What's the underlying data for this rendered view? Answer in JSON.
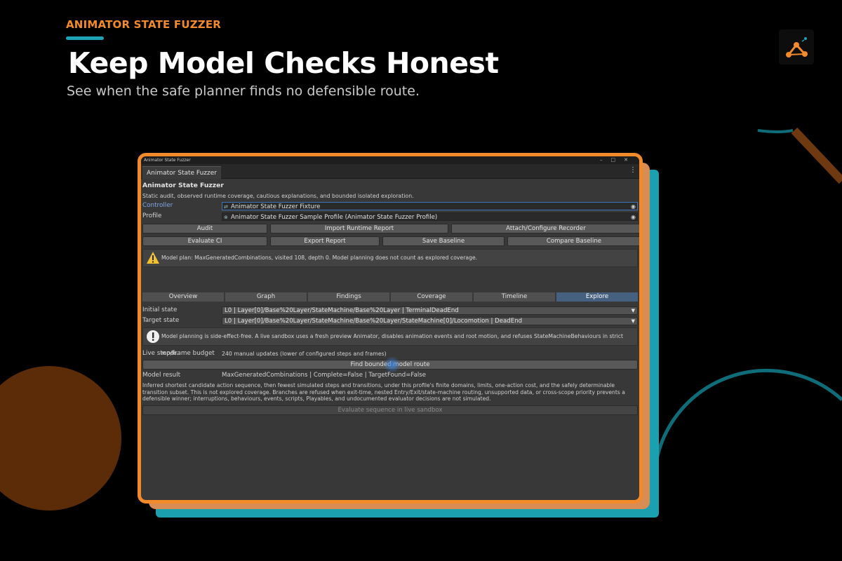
{
  "banner": {
    "kicker": "ANIMATOR STATE FUZZER",
    "headline": "Keep Model Checks Honest",
    "subline": "See when the safe planner finds no defensible route.",
    "accent_orange": "#f28a2a",
    "accent_teal": "#1ea5b5"
  },
  "window": {
    "title": "Animator State Fuzzer",
    "tab_label": "Animator State Fuzzer",
    "heading": "Animator State Fuzzer",
    "description": "Static audit, observed runtime coverage, cautious explanations, and bounded isolated exploration.",
    "controller": {
      "label": "Controller",
      "value": "Animator State Fuzzer Fixture"
    },
    "profile": {
      "label": "Profile",
      "value": "Animator State Fuzzer Sample Profile (Animator State Fuzzer Profile)"
    },
    "buttons_row1": [
      "Audit",
      "Import Runtime Report",
      "Attach/Configure Recorder"
    ],
    "buttons_row2": [
      "Evaluate CI",
      "Export Report",
      "Save Baseline",
      "Compare Baseline"
    ],
    "warning": "Model plan: MaxGeneratedCombinations, visited 108, depth 0. Model planning does not count as explored coverage.",
    "tabs": [
      {
        "label": "Overview",
        "selected": false
      },
      {
        "label": "Graph",
        "selected": false
      },
      {
        "label": "Findings",
        "selected": false
      },
      {
        "label": "Coverage",
        "selected": false
      },
      {
        "label": "Timeline",
        "selected": false
      },
      {
        "label": "Explore",
        "selected": true
      }
    ],
    "initial_state": {
      "label": "Initial state",
      "value": "L0 | Layer[0]/Base%20Layer/StateMachine/Base%20Layer | TerminalDeadEnd"
    },
    "target_state": {
      "label": "Target state",
      "value": "L0 | Layer[0]/Base%20Layer/StateMachine/Base%20Layer/StateMachine[0]/Locomotion | DeadEnd"
    },
    "info": "Model planning is side-effect-free. A live sandbox uses a fresh preview Animator, disables animation events and root motion, and refuses StateMachineBehaviours in strict mode.",
    "budget": {
      "label": "Live step/frame budget",
      "value": "240 manual updates (lower of configured steps and frames)"
    },
    "find_button": "Find bounded model route",
    "model_result": {
      "label": "Model result",
      "value": "MaxGeneratedCombinations | Complete=False | TargetFound=False"
    },
    "explanation": "Inferred shortest candidate action sequence, then fewest simulated steps and transitions, under this profile's finite domains, limits, one-action cost, and the safely determinable transition subset. This is not explored coverage. Branches are refused when exit-time, nested Entry/Exit/state-machine routing, unsupported data, or cross-scope priority prevents a defensible winner; interruptions, behaviours, events, scripts, Playables, and undocumented evaluator decisions are not simulated.",
    "evaluate_button": "Evaluate sequence in live sandbox"
  }
}
